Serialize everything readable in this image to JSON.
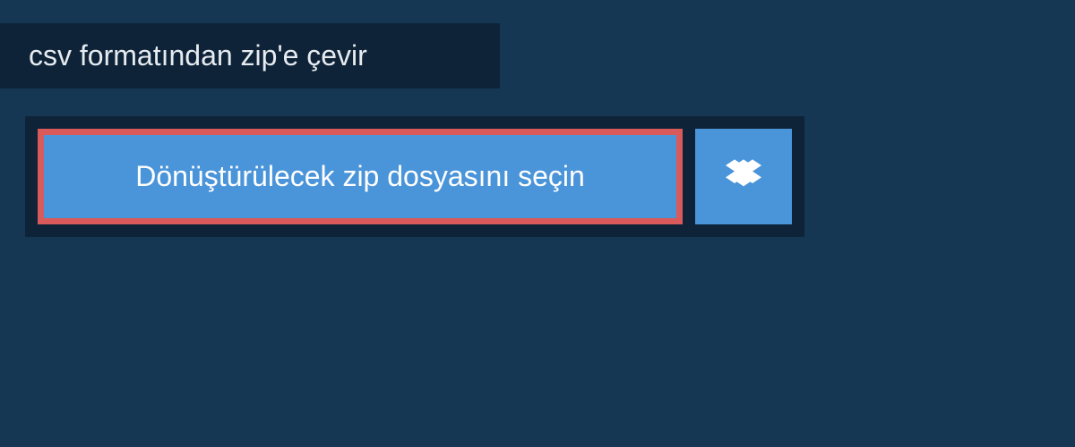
{
  "header": {
    "title": "csv formatından zip'e çevir"
  },
  "upload": {
    "select_file_label": "Dönüştürülecek zip dosyasını seçin",
    "dropbox_icon": "dropbox"
  }
}
